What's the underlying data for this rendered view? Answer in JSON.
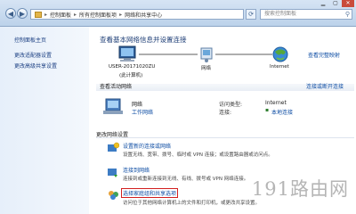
{
  "address": {
    "segments": [
      "控制面板",
      "所有控制面板项",
      "网络和共享中心"
    ]
  },
  "search": {
    "placeholder": "搜索控制面板"
  },
  "sidebar": {
    "items": [
      {
        "label": "控制面板主页"
      },
      {
        "label": "更改适配器设置"
      },
      {
        "label": "更改高级共享设置"
      }
    ]
  },
  "main": {
    "heading": "查看基本网络信息并设置连接",
    "full_map": "查看完整映射",
    "map": {
      "computer_name": "USER-20171020ZU",
      "computer_sub": "(此计算机)",
      "network_label": "网络",
      "internet_label": "Internet"
    },
    "active_section": {
      "title": "查看活动网络",
      "connect_link": "连接或断开连接",
      "network_name": "网络",
      "network_type": "工作网络",
      "access_type_label": "访问类型:",
      "access_type_value": "Internet",
      "connections_label": "连接:",
      "connections_value": "本地连接"
    },
    "change_section": {
      "title": "更改网络设置",
      "tasks": [
        {
          "title": "设置新的连接或网络",
          "desc": "设置无线、宽带、拨号、临时或 VPN 连接；或设置路由器或访问点。"
        },
        {
          "title": "连接到网络",
          "desc": "连接到或重新连接到无线、有线、拨号或 VPN 网络连接。"
        },
        {
          "title": "选择家庭组和共享选项",
          "desc": "访问位于其他网络计算机上的文件和打印机，或更改共享设置。"
        }
      ]
    }
  },
  "watermark": "191路由网",
  "colors": {
    "highlight": "#d21f1f",
    "link": "#0c4ca3",
    "sidebar_bg": "#e6effa"
  }
}
